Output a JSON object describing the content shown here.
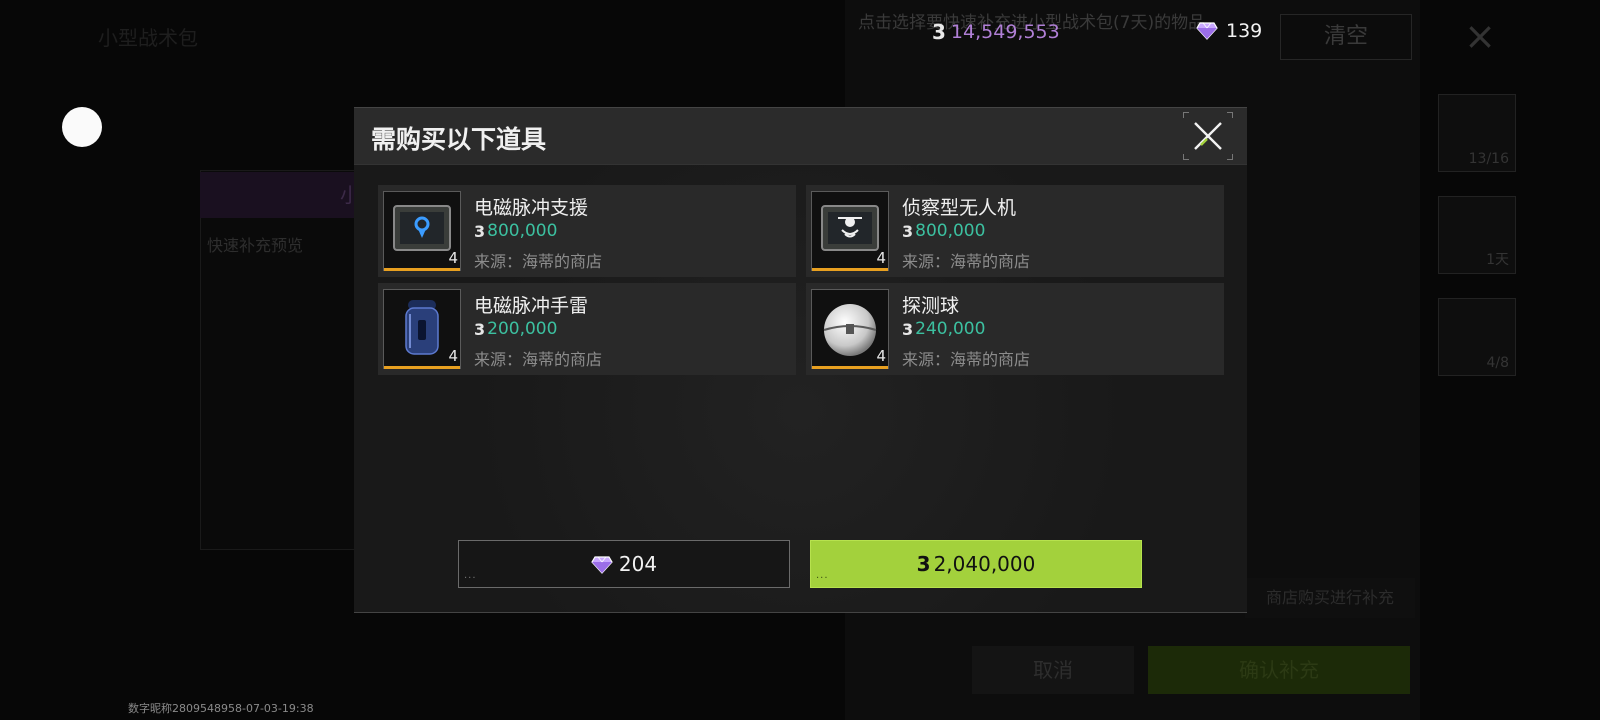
{
  "currency": {
    "coin_value": "14,549,553",
    "gem_value": "139",
    "coin_icon": "3",
    "coin_color": "#b07fd6"
  },
  "background": {
    "hint_text": "点击选择要快速补充进小型战术包(7天)的物品。",
    "left_title": "小型战术包",
    "left_head": "小型战术",
    "left_sub": "快速补充预览",
    "clear_label": "清空",
    "close_icon": "×",
    "slot_1": "13/16",
    "slot_2": "1天",
    "slot_3": "4/8",
    "shop_hint": "商店购买进行补充",
    "cancel_label": "取消",
    "confirm_label": "确认补充"
  },
  "modal": {
    "title": "需购买以下道具",
    "items": [
      {
        "name": "电磁脉冲支援",
        "price": "800,000",
        "source": "来源：海蒂的商店",
        "qty": "4",
        "icon": "emp-support-tablet-icon"
      },
      {
        "name": "侦察型无人机",
        "price": "800,000",
        "source": "来源：海蒂的商店",
        "qty": "4",
        "icon": "recon-drone-tablet-icon"
      },
      {
        "name": "电磁脉冲手雷",
        "price": "200,000",
        "source": "来源：海蒂的商店",
        "qty": "4",
        "icon": "emp-grenade-icon"
      },
      {
        "name": "探测球",
        "price": "240,000",
        "source": "来源：海蒂的商店",
        "qty": "4",
        "icon": "detector-ball-icon"
      }
    ],
    "gem_button_value": "204",
    "coin_button_value": "2,040,000",
    "accent_green": "#a3d13c",
    "rarity_bar_color": "#e8a020"
  },
  "watermark": "数字昵称2809548958-07-03-19:38"
}
